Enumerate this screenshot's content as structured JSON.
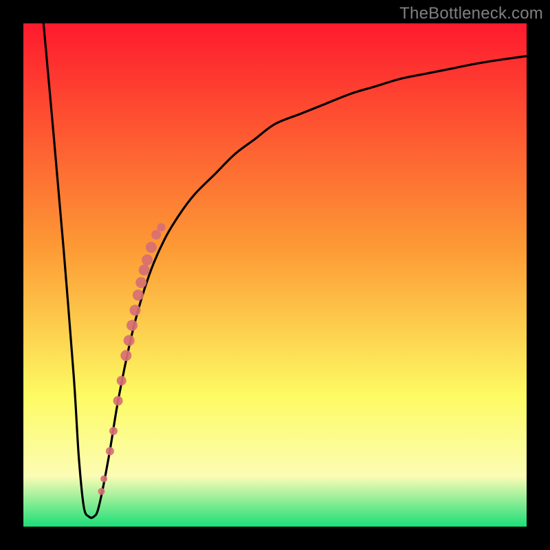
{
  "watermark": "TheBottleneck.com",
  "colors": {
    "frame": "#000000",
    "curve": "#000000",
    "dots": "#d76f73",
    "gradient_top": "#fe1a2e",
    "gradient_mid1": "#fd9b35",
    "gradient_mid2": "#fdfb63",
    "gradient_mid3": "#fcfcb5",
    "gradient_bottom": "#1bde76"
  },
  "chart_data": {
    "type": "line",
    "title": "",
    "xlabel": "",
    "ylabel": "",
    "xlim": [
      0,
      100
    ],
    "ylim": [
      0,
      100
    ],
    "grid": false,
    "series": [
      {
        "name": "bottleneck-curve",
        "x": [
          4,
          6,
          8,
          10,
          11,
          12,
          13,
          14,
          15,
          17,
          19,
          22,
          25,
          28,
          31,
          34,
          38,
          42,
          46,
          50,
          55,
          60,
          65,
          70,
          75,
          80,
          85,
          90,
          95,
          100
        ],
        "y": [
          100,
          78,
          55,
          30,
          14,
          4,
          2,
          2,
          4,
          14,
          26,
          40,
          50,
          57,
          62,
          66,
          70,
          74,
          77,
          80,
          82,
          84,
          86,
          87.5,
          89,
          90,
          91,
          92,
          92.8,
          93.5
        ]
      }
    ],
    "dot_series": {
      "name": "sample-points",
      "x": [
        17.2,
        17.9,
        18.8,
        19.5,
        20.4,
        21.0,
        21.6,
        22.2,
        22.8,
        23.4,
        24.0,
        24.6,
        25.4,
        26.4,
        27.4,
        15.5,
        16.0
      ],
      "y": [
        15.0,
        19.0,
        25.0,
        29.0,
        34.0,
        37.0,
        40.0,
        43.0,
        46.0,
        48.5,
        51.0,
        53.0,
        55.5,
        58.0,
        59.5,
        7.0,
        9.5
      ],
      "r": [
        6,
        6,
        7,
        7,
        8,
        8,
        8,
        8,
        8,
        8,
        8,
        8,
        8,
        7,
        6,
        5,
        5
      ]
    }
  }
}
